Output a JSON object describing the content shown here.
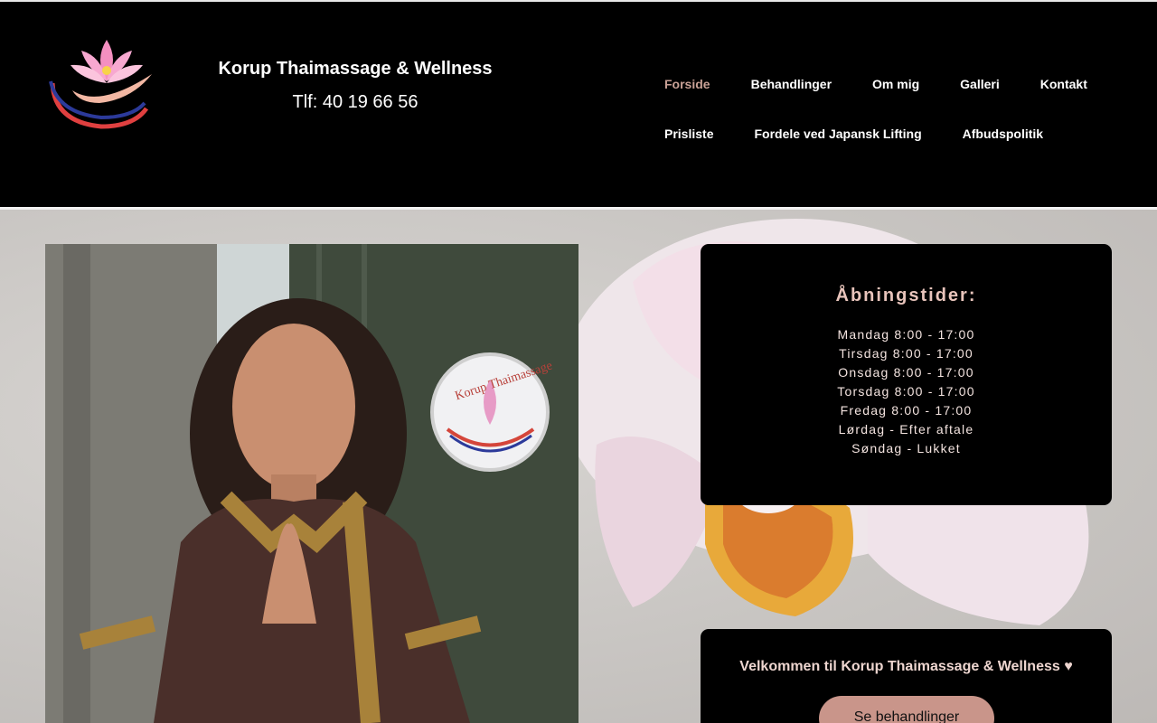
{
  "header": {
    "logo_icon": "lotus-hand-logo",
    "title": "Korup Thaimassage & Wellness",
    "phone": "Tlf: 40 19 66 56"
  },
  "nav": {
    "row1": [
      {
        "label": "Forside",
        "active": true
      },
      {
        "label": "Behandlinger"
      },
      {
        "label": "Om mig"
      },
      {
        "label": "Galleri"
      },
      {
        "label": "Kontakt"
      }
    ],
    "row2": [
      {
        "label": "Prisliste"
      },
      {
        "label": "Fordele ved Japansk Lifting"
      },
      {
        "label": "Afbudspolitik"
      }
    ],
    "active_color": "#c9a196"
  },
  "hours": {
    "title": "Åbningstider:",
    "lines": [
      "Mandag 8:00 - 17:00",
      "Tirsdag 8:00 - 17:00",
      "Onsdag 8:00 - 17:00",
      "Torsdag 8:00 - 17:00",
      "Fredag 8:00 - 17:00",
      "Lørdag - Efter aftale",
      "Søndag - Lukket"
    ]
  },
  "welcome": {
    "text": "Velkommen til Korup Thaimassage & Wellness ♥",
    "button_label": "Se behandlinger",
    "button_color": "#c9958a"
  },
  "photo": {
    "sign_text": "Korup Thaimassage"
  }
}
